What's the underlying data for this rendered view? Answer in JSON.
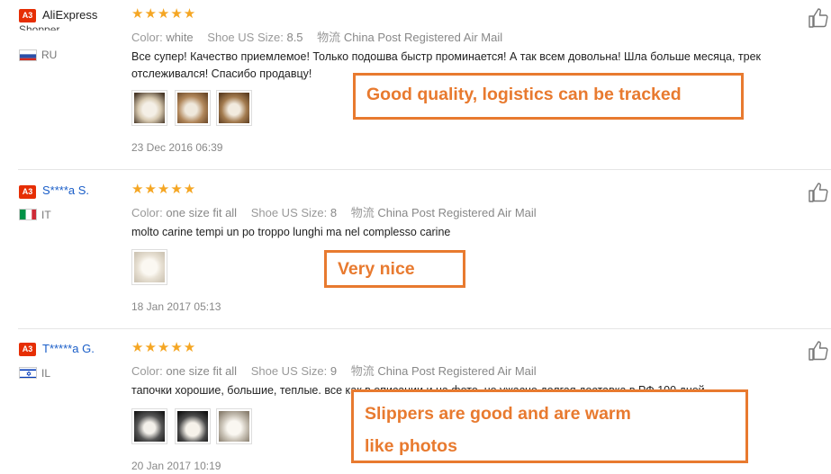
{
  "reviews": [
    {
      "badge": "A3",
      "buyer": "AliExpress",
      "buyer_sub": "Shopper",
      "country": "RU",
      "flag": "russia-flag",
      "stars": "★★★★★",
      "color_key": "Color:",
      "color_val": "white",
      "size_key": "Shoe US Size:",
      "size_val": "8.5",
      "ship_key": "物流",
      "ship_val": "China Post Registered Air Mail",
      "text": "Все супер! Качество приемлемое! Только подошва быстр проминается! А так всем довольна! Шла больше месяца, трек отслеживался! Спасибо продавцу!",
      "date": "23 Dec 2016 06:39",
      "photo_count": 3
    },
    {
      "badge": "A3",
      "buyer": "S****a S.",
      "country": "IT",
      "flag": "italy-flag",
      "stars": "★★★★★",
      "color_key": "Color:",
      "color_val": "one size fit all",
      "size_key": "Shoe US Size:",
      "size_val": "8",
      "ship_key": "物流",
      "ship_val": "China Post Registered Air Mail",
      "text": "molto carine tempi un po troppo lunghi ma nel complesso carine",
      "date": "18 Jan 2017 05:13",
      "photo_count": 1
    },
    {
      "badge": "A3",
      "buyer": "T*****a G.",
      "country": "IL",
      "flag": "israel-flag",
      "stars": "★★★★★",
      "color_key": "Color:",
      "color_val": "one size fit all",
      "size_key": "Shoe US Size:",
      "size_val": "9",
      "ship_key": "物流",
      "ship_val": "China Post Registered Air Mail",
      "text": "тапочки хорошие, большие, теплые. все как в описании и на фото. но ужасно долгая доставка в РФ 100 дней",
      "date": "20 Jan 2017 10:19",
      "photo_count": 3
    }
  ],
  "callouts": {
    "first": "Good quality, logistics can be tracked",
    "second": "Very nice",
    "third_line1": "Slippers are good and are warm",
    "third_line2": "like photos"
  },
  "icons": {
    "helpful": "thumbs-up-icon"
  },
  "colors": {
    "accent": "#e87a2f",
    "badge": "#e62e04",
    "stars": "#f5a623",
    "link": "#1a5ec8"
  }
}
